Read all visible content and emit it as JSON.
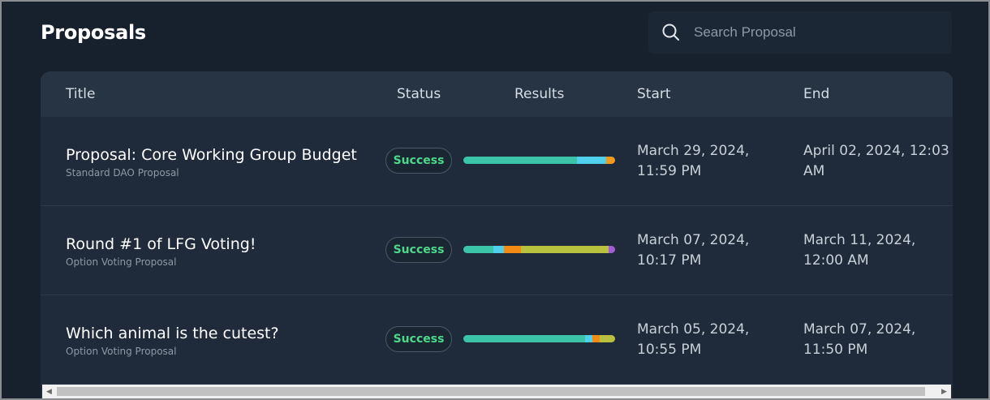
{
  "header": {
    "title": "Proposals"
  },
  "search": {
    "placeholder": "Search Proposal",
    "icon": "search-icon"
  },
  "table": {
    "columns": [
      "Title",
      "Status",
      "Results",
      "Start",
      "End"
    ],
    "rows": [
      {
        "title": "Proposal: Core Working Group Budget",
        "subtitle": "Standard DAO Proposal",
        "status": "Success",
        "results": [
          {
            "color": "#3cc4a8",
            "fraction": 0.75
          },
          {
            "color": "#4fd0ec",
            "fraction": 0.19
          },
          {
            "color": "#f29b1a",
            "fraction": 0.06
          }
        ],
        "start_line1": "March 29, 2024,",
        "start_line2": "11:59 PM",
        "end_line1": "April 02, 2024, 12:03",
        "end_line2": "AM"
      },
      {
        "title": "Round #1 of LFG Voting!",
        "subtitle": "Option Voting Proposal",
        "status": "Success",
        "results": [
          {
            "color": "#3cc4a8",
            "fraction": 0.2
          },
          {
            "color": "#4fd0ec",
            "fraction": 0.07
          },
          {
            "color": "#f28a14",
            "fraction": 0.11
          },
          {
            "color": "#b8c23f",
            "fraction": 0.58
          },
          {
            "color": "#a45bd6",
            "fraction": 0.04
          }
        ],
        "start_line1": "March 07, 2024,",
        "start_line2": "10:17 PM",
        "end_line1": "March 11, 2024,",
        "end_line2": "12:00 AM"
      },
      {
        "title": "Which animal is the cutest?",
        "subtitle": "Option Voting Proposal",
        "status": "Success",
        "results": [
          {
            "color": "#3cc4a8",
            "fraction": 0.8
          },
          {
            "color": "#4fd0ec",
            "fraction": 0.05
          },
          {
            "color": "#f28a14",
            "fraction": 0.05
          },
          {
            "color": "#b8c23f",
            "fraction": 0.1
          }
        ],
        "start_line1": "March 05, 2024,",
        "start_line2": "10:55 PM",
        "end_line1": "March 07, 2024,",
        "end_line2": "11:50 PM"
      }
    ]
  },
  "colors": {
    "background": "#17212d",
    "table_body": "#1f2b3a",
    "table_header": "#263444",
    "success": "#4cd98a"
  }
}
